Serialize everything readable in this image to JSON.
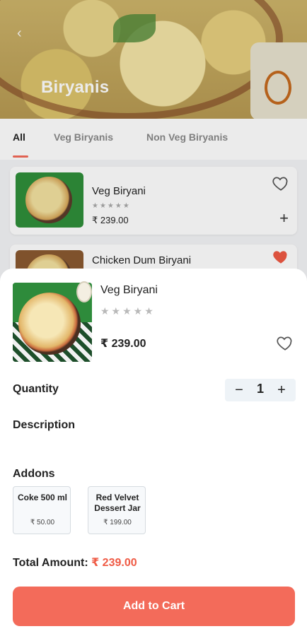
{
  "header": {
    "back_icon": "chevron-left-icon",
    "title": "Biryanis"
  },
  "tabs": [
    {
      "label": "All",
      "active": true
    },
    {
      "label": "Veg Biryanis",
      "active": false
    },
    {
      "label": "Non Veg Biryanis",
      "active": false
    }
  ],
  "list": [
    {
      "name": "Veg Biryani",
      "stars": "★★★★★",
      "price": "₹ 239.00",
      "favorite": false
    },
    {
      "name": "Chicken Dum Biryani",
      "favorite": true
    }
  ],
  "sheet": {
    "item_name": "Veg Biryani",
    "stars": "★★★★★",
    "price": "₹ 239.00",
    "quantity_label": "Quantity",
    "quantity": "1",
    "minus": "−",
    "plus": "+",
    "description_label": "Description",
    "addons_label": "Addons",
    "addons": [
      {
        "name": "Coke 500 ml",
        "price": "₹ 50.00"
      },
      {
        "name": "Red Velvet Dessert Jar",
        "price": "₹ 199.00"
      }
    ],
    "total_label": "Total Amount:",
    "total_amount": "₹ 239.00",
    "cta": "Add to Cart"
  },
  "colors": {
    "accent": "#f36b5a",
    "total_amount": "#ef5a44",
    "heart_filled": "#ef5a44"
  }
}
